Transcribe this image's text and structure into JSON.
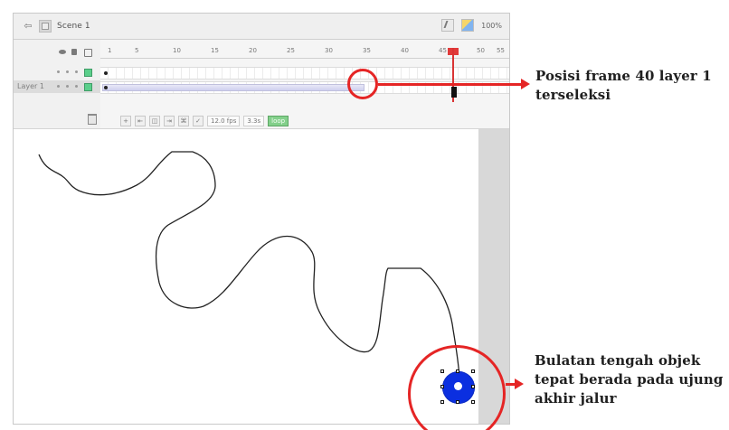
{
  "window": {
    "scene_label": "Scene 1",
    "zoom_label": "100%"
  },
  "timeline": {
    "ruler_numbers": [
      "1",
      "5",
      "10",
      "15",
      "20",
      "25",
      "30",
      "35",
      "40",
      "45",
      "50",
      "55"
    ],
    "layer1_name": "Layer 1",
    "fps": "12.0 fps",
    "time": "3.3s",
    "loop_label": "loop"
  },
  "annotations": {
    "top": "Posisi frame 40 layer 1 terseleksi",
    "bottom": "Bulatan tengah objek tepat berada pada ujung akhir jalur"
  },
  "icons": {
    "back": "back-arrow-icon",
    "scene": "scene-icon",
    "brush": "brush-icon",
    "color": "color-icon",
    "eye": "eye-icon",
    "lock": "lock-icon",
    "outline": "outline-icon",
    "trash": "trash-icon"
  },
  "colors": {
    "callout": "#e52525",
    "object": "#0b2fe0",
    "layer_keyframe": "#5bcf8b"
  }
}
